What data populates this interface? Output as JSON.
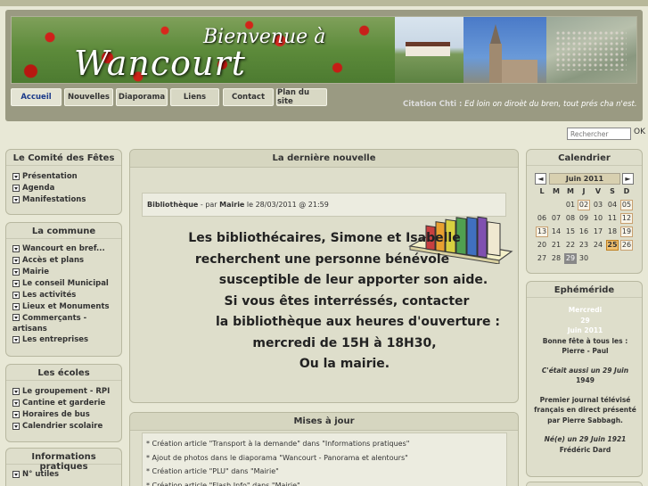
{
  "header": {
    "banner_title_1": "Bienvenue à",
    "banner_title_2": "Wancourt",
    "nav": [
      {
        "label": "Accueil"
      },
      {
        "label": "Nouvelles"
      },
      {
        "label": "Diaporama"
      },
      {
        "label": "Liens"
      },
      {
        "label": "Contact"
      },
      {
        "label": "Plan du site"
      }
    ],
    "citation_label": "Citation Chti :",
    "citation_text": "Ed loin on diroèt du bren, tout prés cha n'est."
  },
  "search": {
    "placeholder": "Rechercher",
    "button": "OK"
  },
  "left": {
    "comite": {
      "title": "Le Comité des Fêtes",
      "items": [
        "Présentation",
        "Agenda",
        "Manifestations"
      ]
    },
    "commune": {
      "title": "La commune",
      "items": [
        "Wancourt en bref...",
        "Accès et plans",
        "Mairie",
        "Le conseil Municipal",
        "Les activités",
        "Lieux et Monuments",
        "Commerçants - artisans",
        "Les entreprises"
      ]
    },
    "ecoles": {
      "title": "Les écoles",
      "items": [
        "Le groupement - RPI",
        "Cantine et garderie",
        "Horaires de bus",
        "Calendrier scolaire"
      ]
    },
    "infos": {
      "title": "Informations pratiques",
      "items": [
        "N° utiles"
      ]
    }
  },
  "center": {
    "news_title": "La dernière nouvelle",
    "news_meta": {
      "category": "Bibliothèque",
      "by": " - par ",
      "author": "Mairie",
      "date": " le 28/03/2011 @ 21:59"
    },
    "news_lines": [
      "Les bibliothécaires, Simone et Isabelle",
      "recherchent une personne bénévole",
      "susceptible de leur apporter son aide.",
      "Si vous êtes interréssés, contacter",
      "la bibliothèque aux heures d'ouverture :",
      "mercredi de 15H à 18H30,",
      "Ou la mairie."
    ],
    "updates_title": "Mises à jour",
    "updates": [
      "* Création article \"Transport à la demande\" dans \"Informations pratiques\"",
      "* Ajout de photos dans le diaporama \"Wancourt - Panorama et alentours\"",
      "* Création article \"PLU\" dans \"Mairie\"",
      "* Création article \"Flash Info\" dans \"Mairie\""
    ]
  },
  "calendar": {
    "title": "Calendrier",
    "prev": "◄",
    "next": "►",
    "month": "Juin 2011",
    "days": [
      "L",
      "M",
      "M",
      "J",
      "V",
      "S",
      "D"
    ],
    "weeks": [
      [
        "",
        "",
        "01",
        "02",
        "03",
        "04",
        "05"
      ],
      [
        "06",
        "07",
        "08",
        "09",
        "10",
        "11",
        "12"
      ],
      [
        "13",
        "14",
        "15",
        "16",
        "17",
        "18",
        "19"
      ],
      [
        "20",
        "21",
        "22",
        "23",
        "24",
        "25",
        "26"
      ],
      [
        "27",
        "28",
        "29",
        "30",
        "",
        "",
        ""
      ]
    ]
  },
  "ephemeride": {
    "title": "Ephéméride",
    "day": "Mercredi",
    "date_num": "29",
    "month_year": "Juin 2011",
    "fete_1": "Bonne fête à tous les :",
    "fete_2": "Pierre - Paul",
    "aussi_1": "C'était aussi un 29 Juin",
    "aussi_2": "1949",
    "event_1": "Premier journal télévisé",
    "event_2": "français en direct présenté",
    "event_3": "par Pierre Sabbagh.",
    "born_1": "Né(e) un 29 Juin 1921",
    "born_2": "Frédéric Dard"
  }
}
